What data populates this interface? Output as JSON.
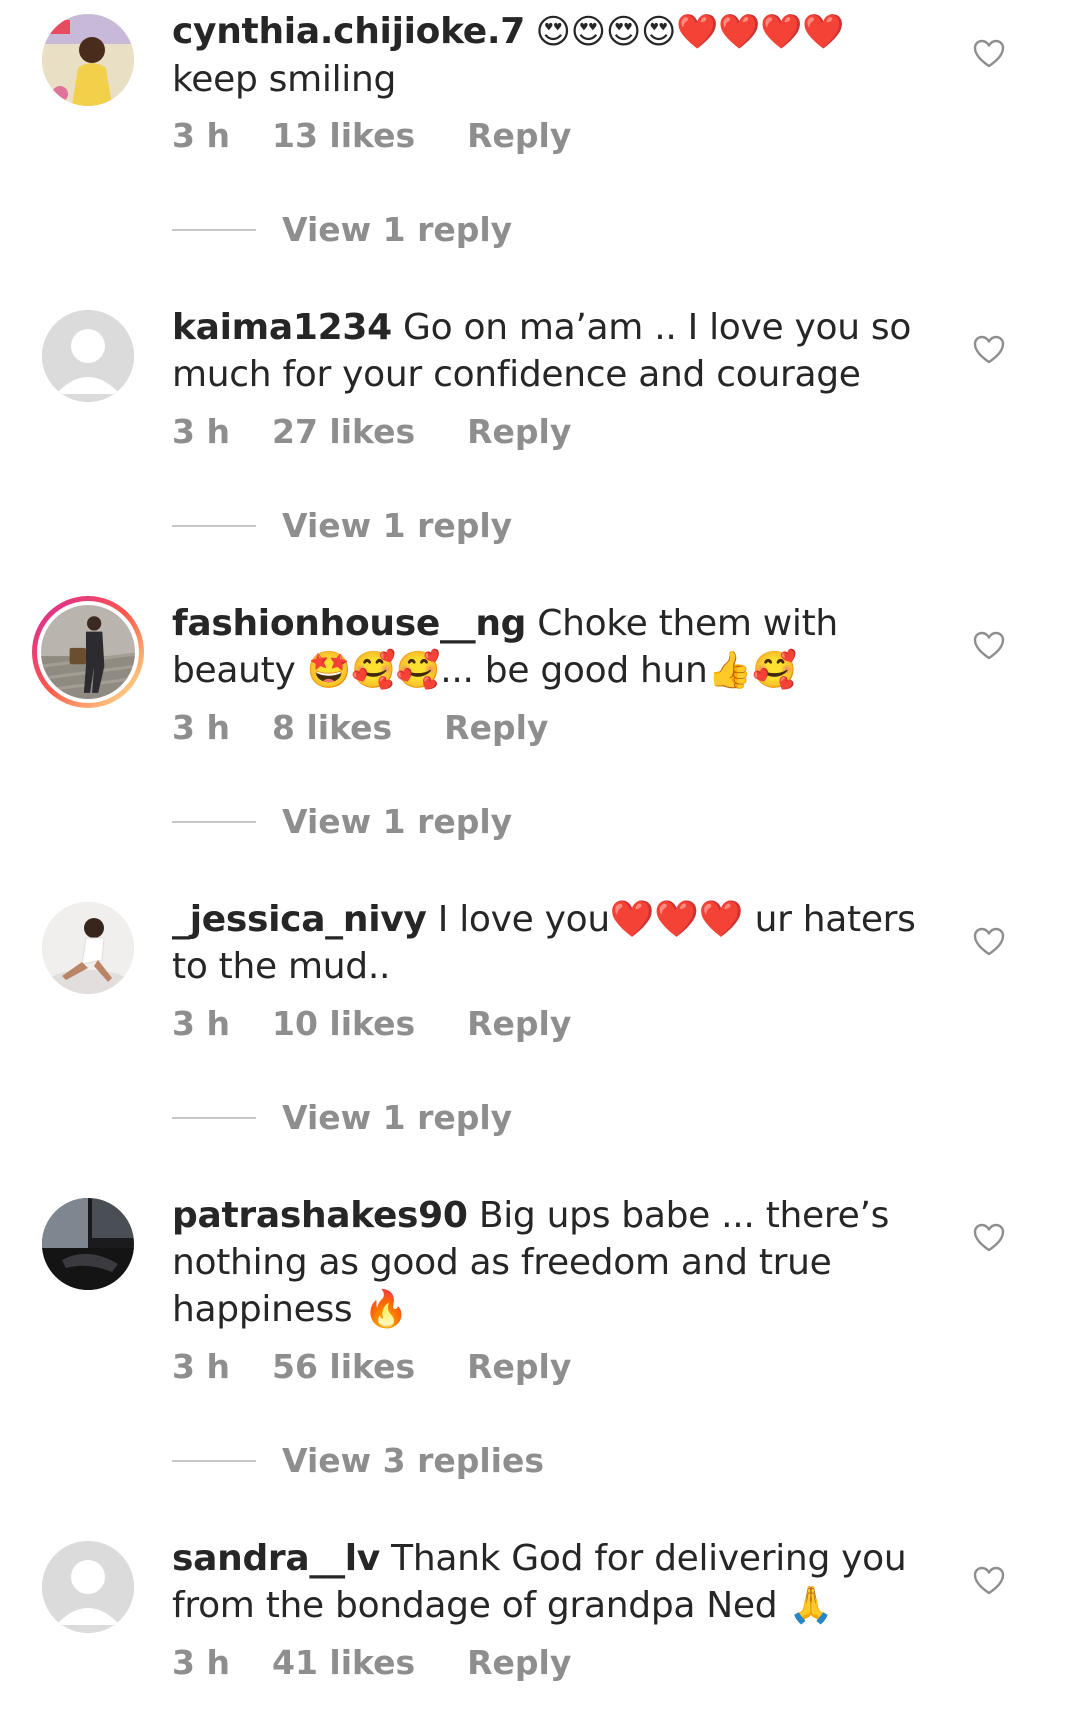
{
  "comments": [
    {
      "username": "cynthia.chijioke.7",
      "text_line1": " 😍😍😍😍❤️❤️❤️❤️",
      "text_rest": "keep smiling",
      "time": "3 h",
      "likes": "13 likes",
      "reply": "Reply",
      "view_replies": "View 1 reply"
    },
    {
      "username": "kaima1234",
      "text": " Go on ma’am .. I love you so much for your confidence and courage",
      "time": "3 h",
      "likes": "27 likes",
      "reply": "Reply",
      "view_replies": "View 1 reply"
    },
    {
      "username": "fashionhouse__ng",
      "text": " Choke them with beauty 🤩🥰🥰... be good hun👍🥰",
      "time": "3 h",
      "likes": "8 likes",
      "reply": "Reply",
      "view_replies": "View 1 reply"
    },
    {
      "username": "_jessica_nivy",
      "text": " I love you❤️❤️❤️ ur haters to the mud..",
      "time": "3 h",
      "likes": "10 likes",
      "reply": "Reply",
      "view_replies": "View 1 reply"
    },
    {
      "username": "patrashakes90",
      "text": " Big ups babe ... there’s nothing as good as freedom and true happiness 🔥",
      "time": "3 h",
      "likes": "56 likes",
      "reply": "Reply",
      "view_replies": "View 3 replies"
    },
    {
      "username": "sandra__lv",
      "text": " Thank God for delivering you from the bondage of grandpa Ned 🙏",
      "time": "3 h",
      "likes": "41 likes",
      "reply": "Reply"
    }
  ],
  "colors": {
    "text": "#262626",
    "secondary": "#8e8e8e",
    "placeholder_avatar": "#dbdbdb"
  }
}
